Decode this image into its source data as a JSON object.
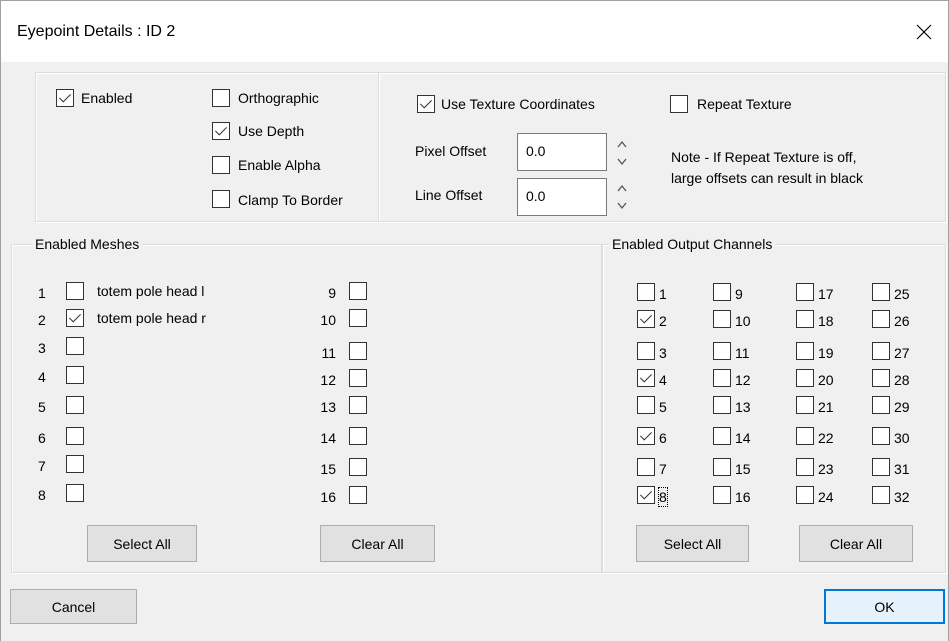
{
  "window": {
    "title": "Eyepoint Details : ID 2"
  },
  "options": {
    "enabled": {
      "label": "Enabled",
      "checked": true
    },
    "orthographic": {
      "label": "Orthographic",
      "checked": false
    },
    "use_depth": {
      "label": "Use Depth",
      "checked": true
    },
    "enable_alpha": {
      "label": "Enable Alpha",
      "checked": false
    },
    "clamp_to_border": {
      "label": "Clamp To Border",
      "checked": false
    }
  },
  "texture": {
    "use_texture_coordinates": {
      "label": "Use Texture Coordinates",
      "checked": true
    },
    "repeat_texture": {
      "label": "Repeat Texture",
      "checked": false
    },
    "pixel_offset_label": "Pixel Offset",
    "pixel_offset_value": "0.0",
    "line_offset_label": "Line Offset",
    "line_offset_value": "0.0",
    "note_line1": "Note - If Repeat Texture is off,",
    "note_line2": "large offsets can result in black"
  },
  "meshes": {
    "legend": "Enabled Meshes",
    "items": [
      {
        "num": "1",
        "label": "totem pole head l",
        "checked": false
      },
      {
        "num": "2",
        "label": "totem pole head r",
        "checked": true
      },
      {
        "num": "3",
        "label": "",
        "checked": false
      },
      {
        "num": "4",
        "label": "",
        "checked": false
      },
      {
        "num": "5",
        "label": "",
        "checked": false
      },
      {
        "num": "6",
        "label": "",
        "checked": false
      },
      {
        "num": "7",
        "label": "",
        "checked": false
      },
      {
        "num": "8",
        "label": "",
        "checked": false
      },
      {
        "num": "9",
        "label": "",
        "checked": false
      },
      {
        "num": "10",
        "label": "",
        "checked": false
      },
      {
        "num": "11",
        "label": "",
        "checked": false
      },
      {
        "num": "12",
        "label": "",
        "checked": false
      },
      {
        "num": "13",
        "label": "",
        "checked": false
      },
      {
        "num": "14",
        "label": "",
        "checked": false
      },
      {
        "num": "15",
        "label": "",
        "checked": false
      },
      {
        "num": "16",
        "label": "",
        "checked": false
      }
    ],
    "select_all_label": "Select All",
    "clear_all_label": "Clear All"
  },
  "channels": {
    "legend": "Enabled Output Channels",
    "items": [
      {
        "num": "1",
        "checked": false
      },
      {
        "num": "2",
        "checked": true
      },
      {
        "num": "3",
        "checked": false
      },
      {
        "num": "4",
        "checked": true
      },
      {
        "num": "5",
        "checked": false
      },
      {
        "num": "6",
        "checked": true
      },
      {
        "num": "7",
        "checked": false
      },
      {
        "num": "8",
        "checked": true
      },
      {
        "num": "9",
        "checked": false
      },
      {
        "num": "10",
        "checked": false
      },
      {
        "num": "11",
        "checked": false
      },
      {
        "num": "12",
        "checked": false
      },
      {
        "num": "13",
        "checked": false
      },
      {
        "num": "14",
        "checked": false
      },
      {
        "num": "15",
        "checked": false
      },
      {
        "num": "16",
        "checked": false
      },
      {
        "num": "17",
        "checked": false
      },
      {
        "num": "18",
        "checked": false
      },
      {
        "num": "19",
        "checked": false
      },
      {
        "num": "20",
        "checked": false
      },
      {
        "num": "21",
        "checked": false
      },
      {
        "num": "22",
        "checked": false
      },
      {
        "num": "23",
        "checked": false
      },
      {
        "num": "24",
        "checked": false
      },
      {
        "num": "25",
        "checked": false
      },
      {
        "num": "26",
        "checked": false
      },
      {
        "num": "27",
        "checked": false
      },
      {
        "num": "28",
        "checked": false
      },
      {
        "num": "29",
        "checked": false
      },
      {
        "num": "30",
        "checked": false
      },
      {
        "num": "31",
        "checked": false
      },
      {
        "num": "32",
        "checked": false
      }
    ],
    "select_all_label": "Select All",
    "clear_all_label": "Clear All"
  },
  "footer": {
    "cancel_label": "Cancel",
    "ok_label": "OK"
  },
  "colors": {
    "accent": "#0078d7",
    "dialog_bg": "#f0f0f0"
  }
}
